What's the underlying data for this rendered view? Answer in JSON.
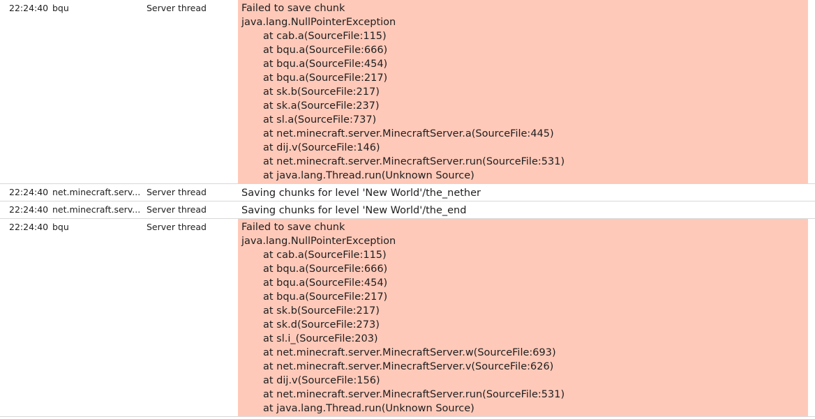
{
  "rows": [
    {
      "time": "22:24:40",
      "logger": "bqu",
      "thread": "Server thread",
      "level": "error",
      "message_lines": [
        "Failed to save chunk",
        "java.lang.NullPointerException",
        "at cab.a(SourceFile:115)",
        "at bqu.a(SourceFile:666)",
        "at bqu.a(SourceFile:454)",
        "at bqu.a(SourceFile:217)",
        "at sk.b(SourceFile:217)",
        "at sk.a(SourceFile:237)",
        "at sl.a(SourceFile:737)",
        "at net.minecraft.server.MinecraftServer.a(SourceFile:445)",
        "at dij.v(SourceFile:146)",
        "at net.minecraft.server.MinecraftServer.run(SourceFile:531)",
        "at java.lang.Thread.run(Unknown Source)"
      ]
    },
    {
      "time": "22:24:40",
      "logger": "net.minecraft.serv...",
      "thread": "Server thread",
      "level": "info",
      "message_lines": [
        "Saving chunks for level 'New World'/the_nether"
      ]
    },
    {
      "time": "22:24:40",
      "logger": "net.minecraft.serv...",
      "thread": "Server thread",
      "level": "info",
      "message_lines": [
        "Saving chunks for level 'New World'/the_end"
      ]
    },
    {
      "time": "22:24:40",
      "logger": "bqu",
      "thread": "Server thread",
      "level": "error",
      "message_lines": [
        "Failed to save chunk",
        "java.lang.NullPointerException",
        "at cab.a(SourceFile:115)",
        "at bqu.a(SourceFile:666)",
        "at bqu.a(SourceFile:454)",
        "at bqu.a(SourceFile:217)",
        "at sk.b(SourceFile:217)",
        "at sk.d(SourceFile:273)",
        "at sl.i_(SourceFile:203)",
        "at net.minecraft.server.MinecraftServer.w(SourceFile:693)",
        "at net.minecraft.server.MinecraftServer.v(SourceFile:626)",
        "at dij.v(SourceFile:156)",
        "at net.minecraft.server.MinecraftServer.run(SourceFile:531)",
        "at java.lang.Thread.run(Unknown Source)"
      ]
    }
  ],
  "colors": {
    "error_background": "#ffc9b9",
    "row_divider": "#d8d8d8",
    "text": "#1e1e1e"
  }
}
